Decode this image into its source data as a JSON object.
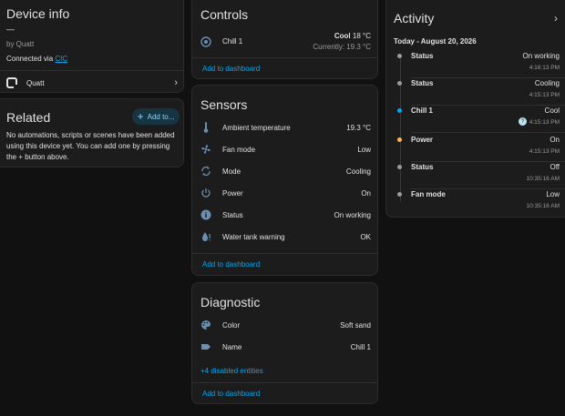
{
  "device_info": {
    "title": "Device info",
    "dash": "—",
    "by": "by Quatt",
    "connected_prefix": "Connected via ",
    "connected_link": "CIC",
    "integration": "Quatt"
  },
  "related": {
    "title": "Related",
    "add_label": "Add to...",
    "description": "No automations, scripts or scenes have been added using this device yet. You can add one by pressing the + button above."
  },
  "controls": {
    "title": "Controls",
    "entity_name": "Chill 1",
    "mode": "Cool",
    "target": "18 °C",
    "current": "Currently: 19.3 °C",
    "add_link": "Add to dashboard"
  },
  "sensors": {
    "title": "Sensors",
    "items": [
      {
        "icon": "thermometer-icon",
        "name": "Ambient temperature",
        "value": "19.3 °C"
      },
      {
        "icon": "fan-icon",
        "name": "Fan mode",
        "value": "Low"
      },
      {
        "icon": "sync-icon",
        "name": "Mode",
        "value": "Cooling"
      },
      {
        "icon": "power-icon",
        "name": "Power",
        "value": "On"
      },
      {
        "icon": "info-icon",
        "name": "Status",
        "value": "On working"
      },
      {
        "icon": "water-icon",
        "name": "Water tank warning",
        "value": "OK"
      }
    ],
    "add_link": "Add to dashboard"
  },
  "diagnostic": {
    "title": "Diagnostic",
    "items": [
      {
        "icon": "palette-icon",
        "name": "Color",
        "value": "Soft sand"
      },
      {
        "icon": "label-icon",
        "name": "Name",
        "value": "Chill 1"
      }
    ],
    "disabled_link": "+4 disabled entities",
    "add_link": "Add to dashboard"
  },
  "activity": {
    "title": "Activity",
    "date": "Today - August 20, 2026",
    "items": [
      {
        "label": "Status",
        "state": "On working",
        "time": "4:16:13 PM",
        "dot": "#9b9b9b"
      },
      {
        "label": "Status",
        "state": "Cooling",
        "time": "4:15:13 PM",
        "dot": "#9b9b9b"
      },
      {
        "label": "Chill 1",
        "state": "Cool",
        "time": "4:15:13 PM",
        "dot": "#03a9f4"
      },
      {
        "label": "Power",
        "state": "On",
        "time": "4:15:13 PM",
        "dot": "#ffb74d"
      },
      {
        "label": "Status",
        "state": "Off",
        "time": "10:35:16 AM",
        "dot": "#9b9b9b"
      },
      {
        "label": "Fan mode",
        "state": "Low",
        "time": "10:35:16 AM",
        "dot": "#9b9b9b"
      }
    ]
  }
}
